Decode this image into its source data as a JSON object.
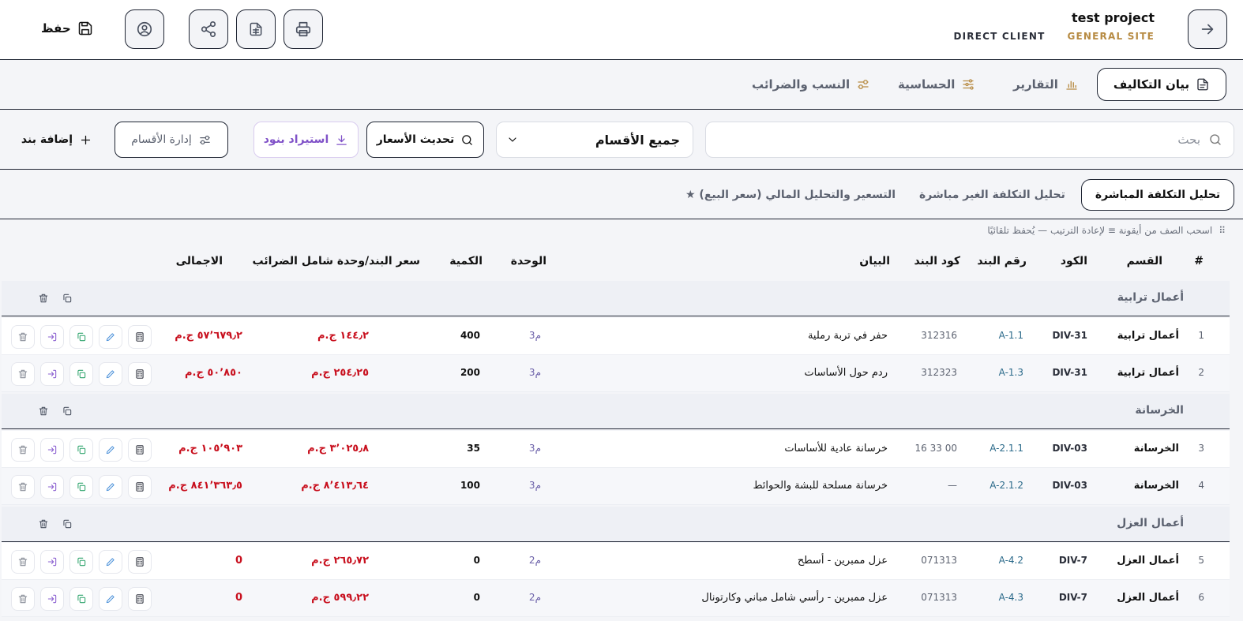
{
  "header": {
    "title": "test project",
    "site": "GENERAL SITE",
    "client": "DIRECT CLIENT",
    "save_label": "حفظ"
  },
  "tabs": [
    {
      "label": "بيان التكاليف",
      "icon": "document-icon",
      "active": true
    },
    {
      "label": "التقارير",
      "icon": "bar-chart-icon",
      "active": false
    },
    {
      "label": "الحساسية",
      "icon": "sliders-icon",
      "active": false
    },
    {
      "label": "النسب والضرائب",
      "icon": "settings-sliders-icon",
      "active": false
    }
  ],
  "toolbar": {
    "search_placeholder": "بحث",
    "division_select": "جميع الأقسام",
    "update_prices": "تحديث الأسعار",
    "import_items": "استيراد بنود",
    "manage_divisions": "إدارة الأقسام",
    "add_item": "إضافة بند"
  },
  "subtabs": [
    {
      "label": "تحليل التكلفة المباشرة",
      "active": true
    },
    {
      "label": "تحليل التكلفة الغير مباشرة",
      "active": false
    },
    {
      "label": "التسعير والتحليل المالي (سعر البيع) ★",
      "active": false
    }
  ],
  "hint": "اسحب الصف من أيقونة ≡ لإعادة الترتيب — يُحفظ تلقائيًا",
  "hint_icon": "⠿",
  "columns": {
    "num": "#",
    "division": "القسم",
    "code": "الكود",
    "item_no": "رقم البند",
    "item_code": "كود البند",
    "description": "البيان",
    "unit": "الوحدة",
    "qty": "الكمية",
    "price": "سعر البند/وحدة شامل الضرائب",
    "total": "الاجمالى"
  },
  "groups": [
    {
      "name": "أعمال ترابية"
    },
    {
      "name": "الخرسانة"
    },
    {
      "name": "أعمال العزل"
    }
  ],
  "rows": [
    {
      "num": "1",
      "division": "أعمال ترابية",
      "code": "DIV-31",
      "item_no": "A-1.1",
      "item_code": "312316",
      "description": "حفر في تربة رملية",
      "unit": "م3",
      "qty": "400",
      "price": "١٤٤٫٢ ج.م",
      "total": "٥٧٬٦٧٩٫٢ ج.م"
    },
    {
      "num": "2",
      "division": "أعمال ترابية",
      "code": "DIV-31",
      "item_no": "A-1.3",
      "item_code": "312323",
      "description": "ردم حول الأساسات",
      "unit": "م3",
      "qty": "200",
      "price": "٢٥٤٫٢٥ ج.م",
      "total": "٥٠٬٨٥٠ ج.م"
    },
    {
      "num": "3",
      "division": "الخرسانة",
      "code": "DIV-03",
      "item_no": "A-2.1.1",
      "item_code": "00 33 16",
      "description": "خرسانة عادية للأساسات",
      "unit": "م3",
      "qty": "35",
      "price": "٣٬٠٢٥٫٨ ج.م",
      "total": "١٠٥٬٩٠٣ ج.م"
    },
    {
      "num": "4",
      "division": "الخرسانة",
      "code": "DIV-03",
      "item_no": "A-2.1.2",
      "item_code": "—",
      "description": "خرسانة مسلحة للبشة والحوائط",
      "unit": "م3",
      "qty": "100",
      "price": "٨٬٤١٣٫٦٤ ج.م",
      "total": "٨٤١٬٣٦٣٫٥ ج.م"
    },
    {
      "num": "5",
      "division": "أعمال العزل",
      "code": "DIV-7",
      "item_no": "A-4.2",
      "item_code": "071313",
      "description": "عزل ممبرين - أسطح",
      "unit": "م2",
      "qty": "0",
      "price": "٢٦٥٫٧٢ ج.م",
      "total": "0"
    },
    {
      "num": "6",
      "division": "أعمال العزل",
      "code": "DIV-7",
      "item_no": "A-4.3",
      "item_code": "071313",
      "description": "عزل ممبرين - رأسي شامل مباني وكارتونال",
      "unit": "م2",
      "qty": "0",
      "price": "٥٩٩٫٢٢ ج.م",
      "total": "0"
    }
  ],
  "colors": {
    "accent_gold": "#b78b43",
    "total_red": "#c8101e",
    "import_purple": "#8052c8"
  }
}
